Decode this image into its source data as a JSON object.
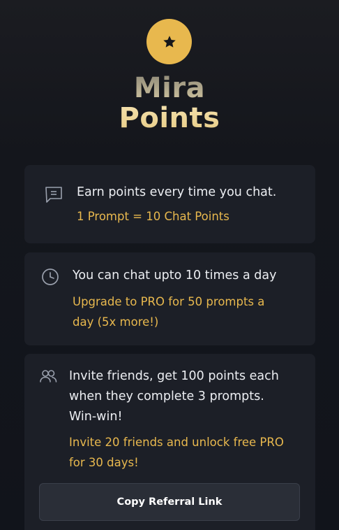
{
  "header": {
    "logo_icon": "star-icon",
    "title_line1": "Mira",
    "title_line2": "Points"
  },
  "cards": [
    {
      "icon": "message-icon",
      "main": "Earn points every time you chat.",
      "sub": "1 Prompt = 10 Chat Points"
    },
    {
      "icon": "clock-icon",
      "main": "You can chat upto 10 times a day",
      "sub_line1": "Upgrade to PRO for 50 prompts a",
      "sub_line2": "day (5x more!)"
    },
    {
      "icon": "users-icon",
      "main_line1": "Invite friends, get 100 points each",
      "main_line2": "when they complete 3 prompts.",
      "main_line3": "Win-win!",
      "sub_line1": "Invite 20 friends and unlock free PRO",
      "sub_line2": "for 30 days!",
      "button_label": "Copy Referral Link"
    }
  ],
  "colors": {
    "accent": "#e8b84e",
    "background": "#12141a",
    "card": "#1c1f27",
    "text": "#eceef2"
  }
}
